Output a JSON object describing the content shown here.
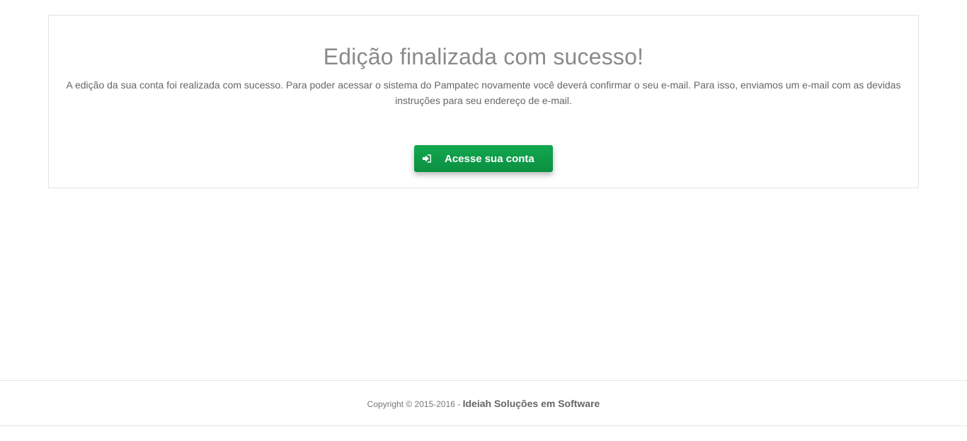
{
  "card": {
    "title": "Edição finalizada com sucesso!",
    "message": "A edição da sua conta foi realizada com sucesso. Para poder acessar o sistema do Pampatec novamente você deverá confirmar o seu e-mail. Para isso, enviamos um e-mail com as devidas instruções para seu endereço de e-mail.",
    "button": {
      "label": "Acesse sua conta",
      "icon": "sign-in-icon",
      "color": "#0e9a48"
    }
  },
  "footer": {
    "copyright": "Copyright © 2015-2016 - ",
    "company": "Ideiah Soluções em Software"
  }
}
